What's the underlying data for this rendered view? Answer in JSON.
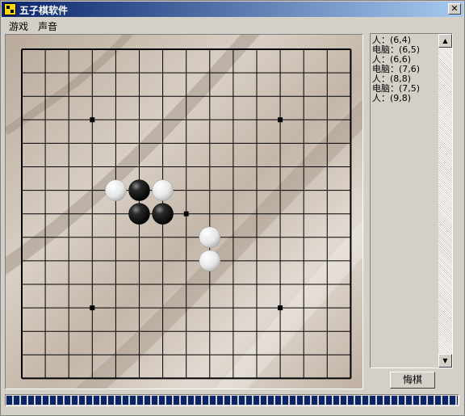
{
  "window": {
    "title": "五子棋软件"
  },
  "menu": {
    "items": [
      "游戏",
      "声音"
    ]
  },
  "board": {
    "size": 15,
    "star_points": [
      [
        3,
        3
      ],
      [
        11,
        3
      ],
      [
        7,
        7
      ],
      [
        3,
        11
      ],
      [
        11,
        11
      ]
    ],
    "stones": [
      {
        "color": "white",
        "x": 4,
        "y": 6
      },
      {
        "color": "black",
        "x": 5,
        "y": 6
      },
      {
        "color": "white",
        "x": 6,
        "y": 6
      },
      {
        "color": "black",
        "x": 5,
        "y": 7
      },
      {
        "color": "black",
        "x": 6,
        "y": 7
      },
      {
        "color": "white",
        "x": 8,
        "y": 8
      },
      {
        "color": "white",
        "x": 8,
        "y": 9
      }
    ]
  },
  "moves": [
    "人：(6,4)",
    "电脑：(6,5)",
    "人：(6,6)",
    "电脑：(7,6)",
    "人：(8,8)",
    "电脑：(7,5)",
    "人：(9,8)"
  ],
  "undo_label": "悔棋",
  "status": {
    "progress_fraction": 1.0
  },
  "colors": {
    "title_start": "#0a246a",
    "title_end": "#a6caf0",
    "progress": "#0a246a"
  },
  "icons": {
    "app": "gomoku-app-icon",
    "close": "close-icon",
    "scroll_up": "scroll-up-arrow-icon",
    "scroll_down": "scroll-down-arrow-icon"
  }
}
